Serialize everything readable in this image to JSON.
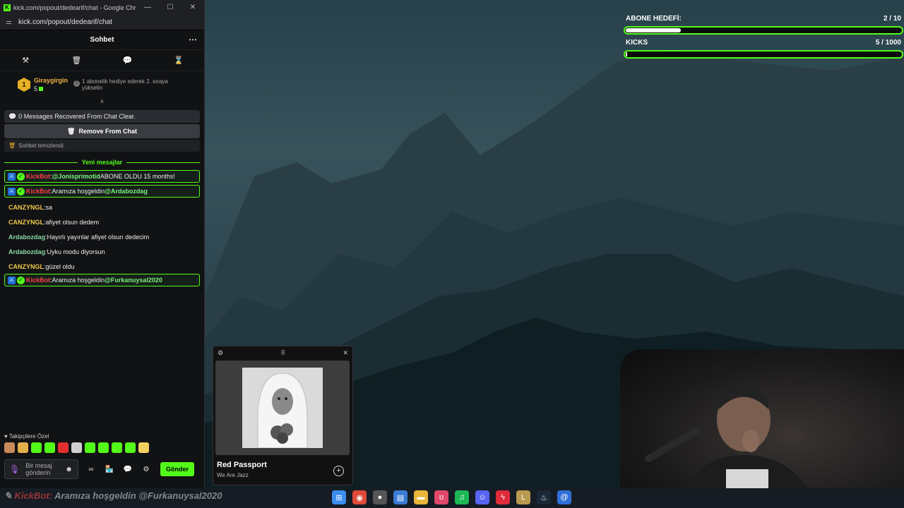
{
  "window": {
    "title": "kick.com/popout/dedearif/chat - Google Chrome",
    "url": "kick.com/popout/dedearif/chat",
    "logo_glyph": "K",
    "minimize_glyph": "—",
    "maximize_glyph": "☐",
    "close_glyph": "✕"
  },
  "chat": {
    "header_title": "Sohbet",
    "more_glyph": "⋯",
    "mod_tools": [
      "⚒",
      "🗑",
      "💬",
      "⌛"
    ],
    "leaderboard": {
      "rank": "1",
      "username": "Giraygirgin",
      "count": "5",
      "info_number": "2",
      "info_text": "1 abonelik hediye ederek 2. sıraya yükselin"
    },
    "collapse_glyph": "⩡",
    "recovered_text": "0 Messages Recovered From Chat Clear.",
    "remove_button": "Remove From Chat",
    "cleared_text": "Sohbet temizlendi.",
    "new_messages_label": "Yeni mesajlar",
    "messages": [
      {
        "user": "KickBot",
        "text": " ABONE OLDU 15 months!",
        "mention": "@Jonisprimotid",
        "mention_first": true
      },
      {
        "user": "KickBot",
        "text": " Aramıza hoşgeldin ",
        "mention": "@Ardabozdag",
        "mention_first": false
      },
      {
        "user": "CANZYNGL",
        "text": " sa"
      },
      {
        "user": "CANZYNGL",
        "text": " afiyet olsun dedem"
      },
      {
        "user": "Ardabozdag",
        "text": " Hayırlı yayınlar afiyet olsun dedecim"
      },
      {
        "user": "Ardabozdag",
        "text": " Uyku modu diyorsun"
      },
      {
        "user": "CANZYNGL",
        "text": " güzel oldu"
      },
      {
        "user": "KickBot",
        "text": " Aramıza hoşgeldin ",
        "mention": "@Furkanuysal2020",
        "mention_first": false
      }
    ],
    "followers_label": "Takipçilere Özel",
    "emote_colors": [
      "#c98a5a",
      "#e2b04a",
      "#53fc18",
      "#53fc18",
      "#e23030",
      "#d0d0d0",
      "#53fc18",
      "#53fc18",
      "#53fc18",
      "#53fc18",
      "#f2d060"
    ],
    "input_placeholder": "Bir mesaj gönderin",
    "send_button": "Gönder",
    "controls": [
      "∞",
      "🏪",
      "💬",
      "⚙"
    ]
  },
  "goals": {
    "subs_label": "ABONE HEDEFİ:",
    "subs_value": "2 / 10",
    "subs_progress": 0.2,
    "kicks_label": "KICKS",
    "kicks_value": "5 / 1000",
    "kicks_progress": 0.005
  },
  "music": {
    "title": "Red Passport",
    "artist": "We Are Jazz",
    "settings_glyph": "⚙",
    "drag_glyph": "⠿",
    "close_glyph": "✕",
    "add_glyph": "+"
  },
  "ticker": {
    "user": "KickBot:",
    "text": " Aramıza hoşgeldin @Furkanuysal2020"
  },
  "taskbar_icons": [
    {
      "name": "windows-start-icon",
      "glyph": "⊞",
      "color": "#3b8ef0"
    },
    {
      "name": "chrome-icon",
      "glyph": "◉",
      "color": "#e04a3a"
    },
    {
      "name": "obs-icon",
      "glyph": "●",
      "color": "#555555"
    },
    {
      "name": "store-icon",
      "glyph": "▤",
      "color": "#3a7bd5"
    },
    {
      "name": "file-explorer-icon",
      "glyph": "▬",
      "color": "#e8b63a"
    },
    {
      "name": "app-icon",
      "glyph": "ʊ",
      "color": "#e04a6a"
    },
    {
      "name": "spotify-icon",
      "glyph": "♫",
      "color": "#1db954"
    },
    {
      "name": "discord-icon",
      "glyph": "☺",
      "color": "#5865f2"
    },
    {
      "name": "flash-icon",
      "glyph": "ϟ",
      "color": "#e02a3a"
    },
    {
      "name": "league-icon",
      "glyph": "L",
      "color": "#b89a50"
    },
    {
      "name": "steam-icon",
      "glyph": "♨",
      "color": "#1b2838"
    },
    {
      "name": "mail-icon",
      "glyph": "@",
      "color": "#2f6fd8"
    }
  ]
}
